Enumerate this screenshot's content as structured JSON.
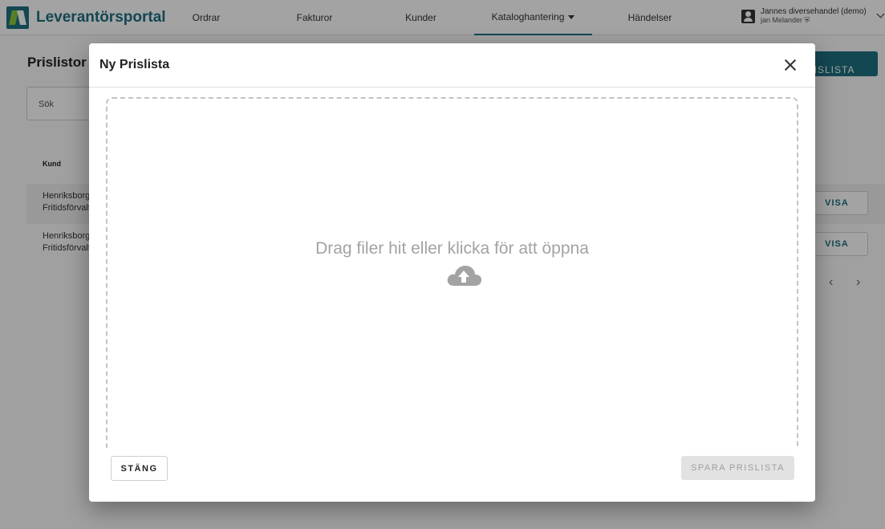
{
  "app": {
    "name": "Leverantörsportal"
  },
  "nav": {
    "items": [
      {
        "label": "Ordrar"
      },
      {
        "label": "Fakturor"
      },
      {
        "label": "Kunder"
      },
      {
        "label": "Kataloghantering",
        "active": true,
        "has_dropdown": true
      },
      {
        "label": "Händelser"
      }
    ]
  },
  "account": {
    "company": "Jannes diversehandel (demo)",
    "user": "jan Melander"
  },
  "page": {
    "title": "Prislistor",
    "new_button": "NY PRISLISTA",
    "search_placeholder": "Sök",
    "column_customer": "Kund",
    "rows": [
      {
        "line1": "Henriksborg",
        "line2": "Fritidsförvaltning",
        "action": "VISA"
      },
      {
        "line1": "Henriksborg",
        "line2": "Fritidsförvaltning",
        "action": "VISA"
      }
    ],
    "pager": {
      "prev": "‹",
      "next": "›"
    }
  },
  "dialog": {
    "title": "Ny Prislista",
    "dropzone_text": "Drag filer hit eller klicka för att öppna",
    "close_button": "STÄNG",
    "save_button": "SPARA PRISLISTA",
    "save_disabled": true
  },
  "colors": {
    "brand": "#1e6f80",
    "logo_green": "#8cc63f",
    "dropzone_text": "#a3a3a3"
  }
}
